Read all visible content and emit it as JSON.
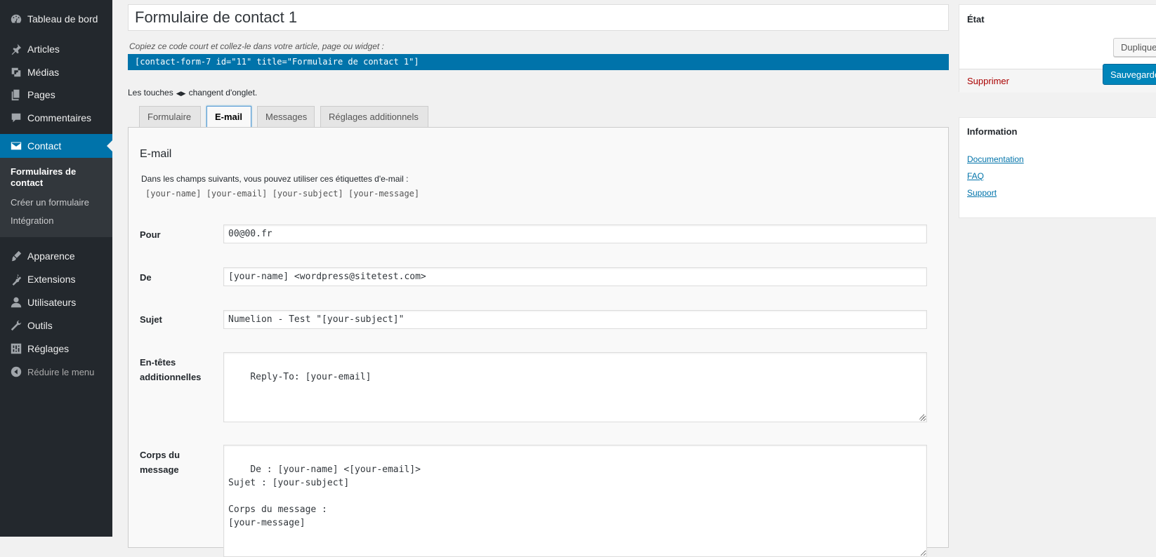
{
  "sidebar": {
    "items": [
      {
        "label": "Tableau de bord",
        "icon": "dashboard-icon"
      },
      {
        "label": "Articles",
        "icon": "pin-icon"
      },
      {
        "label": "Médias",
        "icon": "media-icon"
      },
      {
        "label": "Pages",
        "icon": "pages-icon"
      },
      {
        "label": "Commentaires",
        "icon": "comment-icon"
      },
      {
        "label": "Contact",
        "icon": "envelope-icon"
      },
      {
        "label": "Apparence",
        "icon": "brush-icon"
      },
      {
        "label": "Extensions",
        "icon": "plugin-icon"
      },
      {
        "label": "Utilisateurs",
        "icon": "user-icon"
      },
      {
        "label": "Outils",
        "icon": "wrench-icon"
      },
      {
        "label": "Réglages",
        "icon": "settings-icon"
      },
      {
        "label": "Réduire le menu",
        "icon": "collapse-icon"
      }
    ],
    "submenu": {
      "current": "Formulaires de contact",
      "create": "Créer un formulaire",
      "integration": "Intégration"
    }
  },
  "editor": {
    "title_value": "Formulaire de contact 1",
    "shortcode_hint": "Copiez ce code court et collez-le dans votre article, page ou widget :",
    "shortcode": "[contact-form-7 id=\"11\" title=\"Formulaire de contact 1\"]",
    "keys_hint_before": "Les touches",
    "keys_hint_after": "changent d'onglet.",
    "keys_arrows": "◀▶"
  },
  "tabs": [
    {
      "label": "Formulaire",
      "active": false
    },
    {
      "label": "E-mail",
      "active": true
    },
    {
      "label": "Messages",
      "active": false
    },
    {
      "label": "Réglages additionnels",
      "active": false
    }
  ],
  "mail_panel": {
    "heading": "E-mail",
    "description": "Dans les champs suivants, vous pouvez utiliser ces étiquettes d'e-mail :",
    "tags": "[your-name] [your-email] [your-subject] [your-message]",
    "fields": {
      "to": {
        "label": "Pour",
        "value": "00@00.fr"
      },
      "from": {
        "label": "De",
        "value": "[your-name] <wordpress@sitetest.com>"
      },
      "subject": {
        "label": "Sujet",
        "value": "Numelion - Test \"[your-subject]\""
      },
      "headers": {
        "label_line1": "En-têtes",
        "label_line2": "additionnelles",
        "value": "Reply-To: [your-email]"
      },
      "body": {
        "label_line1": "Corps du",
        "label_line2": "message",
        "value": "De : [your-name] <[your-email]>\nSujet : [your-subject]\n\nCorps du message :\n[your-message]"
      }
    }
  },
  "status_box": {
    "title": "État",
    "duplicate_label": "Dupliquer",
    "delete_label": "Supprimer",
    "save_label": "Sauvegarder"
  },
  "info_box": {
    "title": "Information",
    "links": [
      "Documentation",
      "FAQ",
      "Support"
    ]
  },
  "colors": {
    "sidebar_bg": "#23282d",
    "submenu_bg": "#32373c",
    "accent": "#0073aa",
    "delete": "#aa0000"
  }
}
